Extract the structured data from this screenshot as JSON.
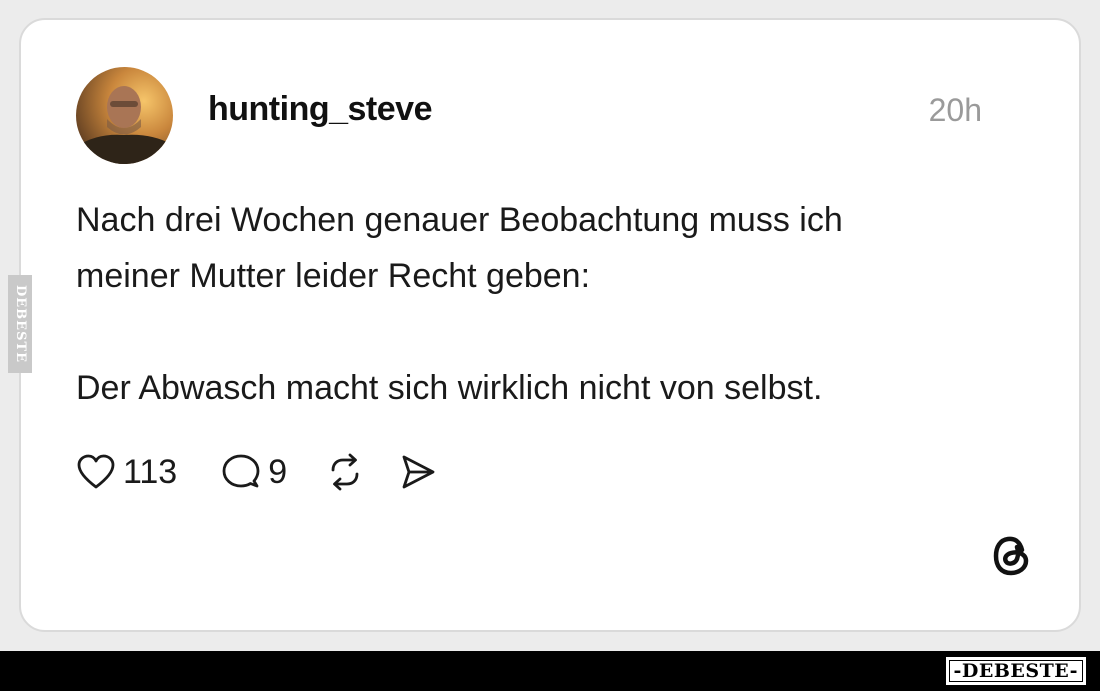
{
  "post": {
    "username": "hunting_steve",
    "time": "20h",
    "text_line1": "Nach drei Wochen genauer Beobachtung muss ich",
    "text_line2": "meiner Mutter leider Recht geben:",
    "text_line3": "Der Abwasch macht sich wirklich nicht von selbst.",
    "likes": "113",
    "replies": "9"
  },
  "icons": {
    "like": "heart-icon",
    "reply": "comment-icon",
    "repost": "repost-icon",
    "share": "send-icon",
    "brand": "threads-logo-icon"
  },
  "watermark": {
    "side": "DEBESTE",
    "bottom": "-DEBESTE-"
  },
  "colors": {
    "time": "#9a9a9a",
    "text": "#1a1a1a",
    "card_border": "#dadada"
  }
}
